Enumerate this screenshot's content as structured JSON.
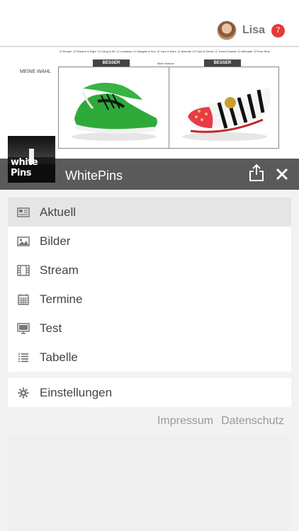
{
  "header": {
    "user_name": "Lisa",
    "notification_count": "7"
  },
  "web_content": {
    "categories": [
      "People",
      "Fashion & Style",
      "Living & Art",
      "Locations",
      "Gadgets & Fun",
      "Cars & More",
      "Animals",
      "Food & Drinks",
      "Trend-Contest",
      "selfmade",
      "Free Time"
    ],
    "meine_wahl": "MEINE WAHL",
    "besser_label": "BESSER",
    "mehr_schuhe": "Mehr Schuhe"
  },
  "drawer": {
    "app_title": "WhitePins",
    "logo_text": "white Pins",
    "menu_items": [
      {
        "label": "Aktuell",
        "icon": "newspaper-icon"
      },
      {
        "label": "Bilder",
        "icon": "image-icon"
      },
      {
        "label": "Stream",
        "icon": "film-icon"
      },
      {
        "label": "Termine",
        "icon": "calendar-icon"
      },
      {
        "label": "Test",
        "icon": "monitor-icon"
      },
      {
        "label": "Tabelle",
        "icon": "list-icon"
      }
    ],
    "settings_label": "Einstellungen",
    "footer": {
      "impressum": "Impressum",
      "datenschutz": "Datenschutz"
    }
  },
  "colors": {
    "drawer_header": "#5a5a5a",
    "badge": "#e53935",
    "active_item": "#e5e5e5"
  }
}
